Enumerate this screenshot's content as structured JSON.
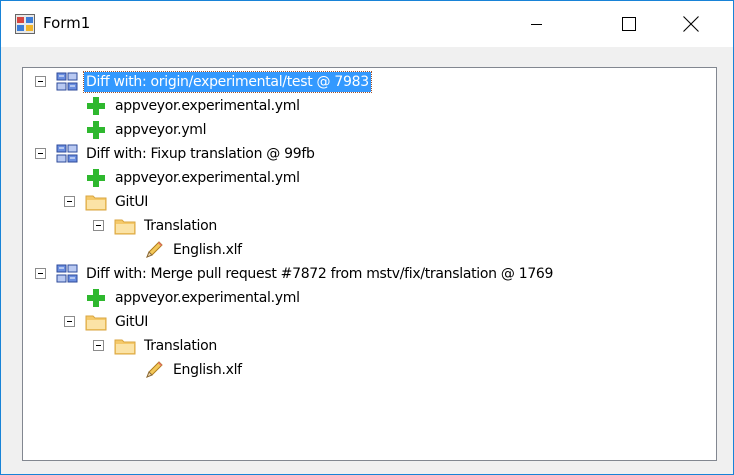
{
  "window": {
    "title": "Form1"
  },
  "tree": {
    "items": [
      {
        "label": "Diff with: origin/experimental/test @ 7983",
        "type": "diff",
        "level": 0,
        "selected": true
      },
      {
        "label": "appveyor.experimental.yml",
        "type": "added",
        "level": 1
      },
      {
        "label": "appveyor.yml",
        "type": "added",
        "level": 1
      },
      {
        "label": "Diff with: Fixup translation @ 99fb",
        "type": "diff",
        "level": 0
      },
      {
        "label": "appveyor.experimental.yml",
        "type": "added",
        "level": 1
      },
      {
        "label": "GitUI",
        "type": "folder",
        "level": 1
      },
      {
        "label": "Translation",
        "type": "folder",
        "level": 2
      },
      {
        "label": "English.xlf",
        "type": "modified",
        "level": 3
      },
      {
        "label": "Diff with: Merge pull request #7872 from mstv/fix/translation @ 1769",
        "type": "diff",
        "level": 0
      },
      {
        "label": "appveyor.experimental.yml",
        "type": "added",
        "level": 1
      },
      {
        "label": "GitUI",
        "type": "folder",
        "level": 1
      },
      {
        "label": "Translation",
        "type": "folder",
        "level": 2
      },
      {
        "label": "English.xlf",
        "type": "modified",
        "level": 3
      }
    ]
  },
  "colors": {
    "selection": "#3399ff",
    "window_border": "#1883d7",
    "added_icon": "#2eb82e",
    "folder_icon": "#f5c96a"
  },
  "icons": {
    "diff": "diff-icon",
    "added": "plus-icon",
    "folder": "folder-icon",
    "modified": "pencil-icon"
  }
}
